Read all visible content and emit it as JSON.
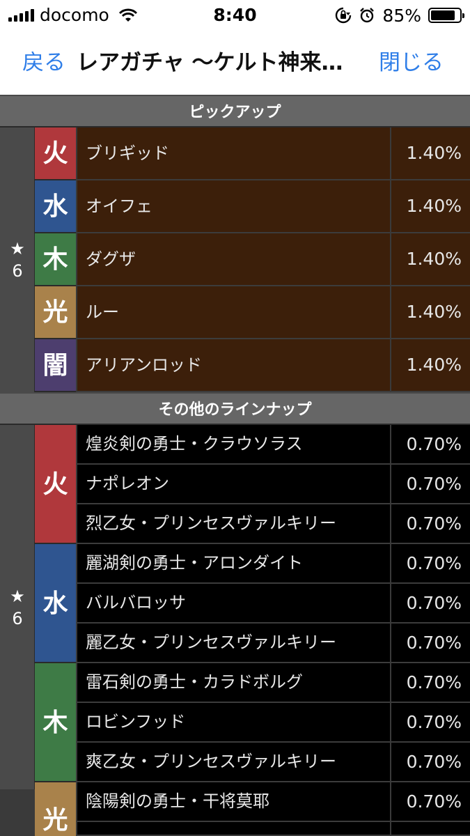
{
  "status": {
    "carrier": "docomo",
    "time": "8:40",
    "battery": "85%",
    "battery_level": 0.85
  },
  "nav": {
    "back": "戻る",
    "title": "レアガチャ 〜ケルト神来…",
    "close": "閉じる"
  },
  "colors": {
    "fire": "#b0383c",
    "water": "#2f5590",
    "wood": "#3e7b46",
    "light": "#a9824b",
    "dark": "#4d3e6e"
  },
  "pickup": {
    "header": "ピックアップ",
    "star": "★",
    "rarity": "6",
    "rows": [
      {
        "attr": "火",
        "name": "ブリギッド",
        "rate": "1.40%"
      },
      {
        "attr": "水",
        "name": "オイフェ",
        "rate": "1.40%"
      },
      {
        "attr": "木",
        "name": "ダグザ",
        "rate": "1.40%"
      },
      {
        "attr": "光",
        "name": "ルー",
        "rate": "1.40%"
      },
      {
        "attr": "闇",
        "name": "アリアンロッド",
        "rate": "1.40%"
      }
    ]
  },
  "others": {
    "header": "その他のラインナップ",
    "star": "★",
    "rarity": "6",
    "groups": [
      {
        "attr": "火",
        "rows": [
          {
            "name": "煌炎剣の勇士・クラウソラス",
            "rate": "0.70%"
          },
          {
            "name": "ナポレオン",
            "rate": "0.70%"
          },
          {
            "name": "烈乙女・プリンセスヴァルキリー",
            "rate": "0.70%"
          }
        ]
      },
      {
        "attr": "水",
        "rows": [
          {
            "name": "麗湖剣の勇士・アロンダイト",
            "rate": "0.70%"
          },
          {
            "name": "バルバロッサ",
            "rate": "0.70%"
          },
          {
            "name": "麗乙女・プリンセスヴァルキリー",
            "rate": "0.70%"
          }
        ]
      },
      {
        "attr": "木",
        "rows": [
          {
            "name": "雷石剣の勇士・カラドボルグ",
            "rate": "0.70%"
          },
          {
            "name": "ロビンフッド",
            "rate": "0.70%"
          },
          {
            "name": "爽乙女・プリンセスヴァルキリー",
            "rate": "0.70%"
          }
        ]
      },
      {
        "attr": "光",
        "rows": [
          {
            "name": "陰陽剣の勇士・干将莫耶",
            "rate": "0.70%"
          }
        ]
      }
    ]
  }
}
